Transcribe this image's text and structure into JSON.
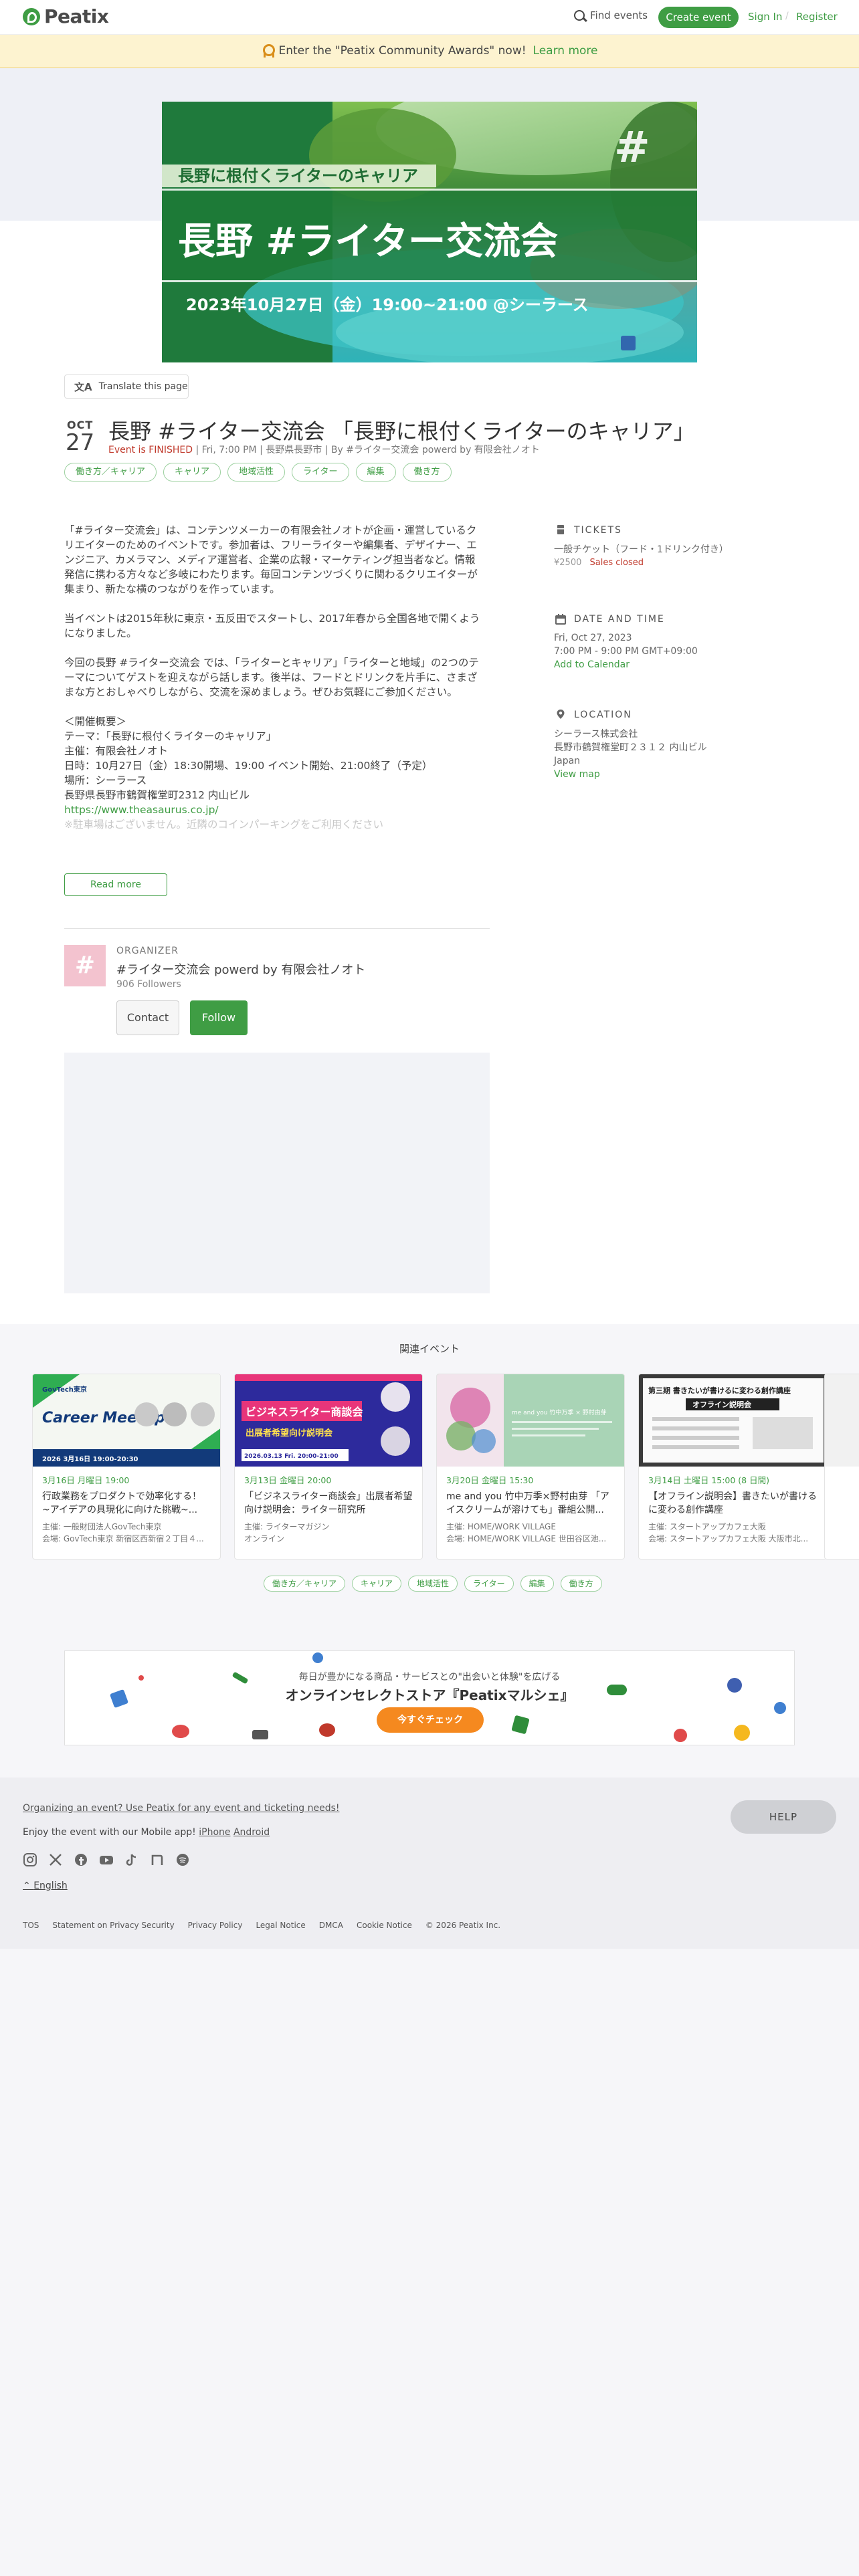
{
  "header": {
    "logo": "Peatix",
    "find_events": "Find events",
    "create_event": "Create event",
    "sign_in": "Sign In",
    "separator": "/",
    "register": "Register"
  },
  "banner": {
    "text": "Enter the \"Peatix Community Awards\" now!",
    "link": "Learn more"
  },
  "cover": {
    "subtitle": "長野に根付くライターのキャリア",
    "title": "長野 #ライター交流会",
    "datetime": "2023年10月27日（金）19:00~21:00 @シーラース",
    "hash_mark": "#"
  },
  "translate_button": "Translate this page",
  "event": {
    "month": "OCT",
    "day": "27",
    "title": "長野 #ライター交流会 「長野に根付くライターのキャリア」",
    "status": "Event is FINISHED",
    "meta": "| Fri, 7:00 PM | 長野県長野市 | By #ライター交流会 powerd by 有限会社ノオト"
  },
  "tags": [
    "働き方／キャリア",
    "キャリア",
    "地域活性",
    "ライター",
    "編集",
    "働き方"
  ],
  "description": {
    "para1": [
      "「#ライター交流会」は、コンテンツメーカーの有限会社ノオトが企画・運営しているク",
      "リエイターのためのイベントです。参加者は、フリーライターや編集者、デザイナー、エ",
      "ンジニア、カメラマン、メディア運営者、企業の広報・マーケティング担当者など。情報",
      "発信に携わる方々など多岐にわたります。毎回コンテンツづくりに関わるクリエイターが",
      "集まり、新たな横のつながりを作っています。"
    ],
    "para2": [
      "当イベントは2015年秋に東京・五反田でスタートし、2017年春から全国各地で開くよう",
      "になりました。"
    ],
    "para3": [
      "今回の長野 #ライター交流会 では、「ライターとキャリア」「ライターと地域」の2つのテ",
      "ーマについてゲストを迎えながら話します。後半は、フードとドリンクを片手に、さまざ",
      "まな方とおしゃべりしながら、交流を深めましょう。ぜひお気軽にご参加ください。"
    ],
    "outline": [
      "＜開催概要＞",
      "テーマ：「長野に根付くライターのキャリア」",
      "主催：有限会社ノオト",
      "日時：10月27日（金）18:30開場、19:00 イベント開始、21:00終了（予定）",
      "場所：シーラース",
      "長野県長野市鶴賀権堂町2312 内山ビル"
    ],
    "url": "https://www.theasaurus.co.jp/",
    "faded": "※駐車場はございません。近隣のコインパーキングをご利用ください",
    "read_more": "Read more"
  },
  "sidebar": {
    "tickets_heading": "TICKETS",
    "ticket_name": "一般チケット（フード・1ドリンク付き）",
    "ticket_price": "¥2500",
    "ticket_status": "Sales closed",
    "date_heading": "DATE AND TIME",
    "date_line1": "Fri, Oct 27, 2023",
    "date_line2": "7:00 PM - 9:00 PM GMT+09:00",
    "add_calendar": "Add to Calendar",
    "location_heading": "LOCATION",
    "venue": "シーラース株式会社",
    "address": "長野市鶴賀権堂町２３１２ 内山ビル",
    "country": "Japan",
    "view_map": "View map"
  },
  "organizer": {
    "label": "ORGANIZER",
    "name": "#ライター交流会 powerd by 有限会社ノオト",
    "followers": "906 Followers",
    "contact": "Contact",
    "follow": "Follow",
    "avatar": "#"
  },
  "related": {
    "title": "関連イベント",
    "cards": [
      {
        "date": "3月16日 月曜日 19:00",
        "title": "行政業務をプロダクトで効率化する！ ~アイデアの具現化に向けた挑戦~...",
        "host": "主催: 一般財団法人GovTech東京",
        "venue": "会場: GovTech東京 新宿区西新宿２丁目４...",
        "img_title": "Career Meetup",
        "img_tag": "GovTech東京",
        "img_date": "2026 3月16日 19:00-20:30"
      },
      {
        "date": "3月13日 金曜日 20:00",
        "title": "「ビジネスライター商談会」出展者希望向け説明会：ライター研究所",
        "host": "主催: ライターマガジン",
        "venue": "オンライン",
        "img_title": "ビジネスライター商談会",
        "img_sub": "出展者希望向け説明会",
        "img_date": "2026.03.13 Fri. 20:00-21:00"
      },
      {
        "date": "3月20日 金曜日 15:30",
        "title": "me and you 竹中万季×野村由芽 「アイスクリームが溶けても」番組公開...",
        "host": "主催: HOME/WORK VILLAGE",
        "venue": "会場: HOME/WORK VILLAGE 世田谷区池...",
        "img_text": "me and you 竹中万季 × 野村由芽"
      },
      {
        "date": "3月14日 土曜日 15:00 (8 日間)",
        "title": "【オフライン説明会】書きたいが書けるに変わる創作講座",
        "host": "主催: スタートアップカフェ大阪",
        "venue": "会場: スタートアップカフェ大阪 大阪市北...",
        "img_title": "第三期 書きたいが書けるに変わる創作講座",
        "img_sub": "オフライン説明会"
      }
    ]
  },
  "ad": {
    "line1": "毎日が豊かになる商品・サービスとの\"出会いと体験\"を広げる",
    "line2": "オンラインセレクトストア『Peatixマルシェ』",
    "button": "今すぐチェック"
  },
  "footer": {
    "organizing": "Organizing an event? Use Peatix for any event and ticketing needs!",
    "app_text": "Enjoy the event with our Mobile app!",
    "iphone": "iPhone",
    "android": "Android",
    "help": "HELP",
    "language": "English",
    "links": [
      "TOS",
      "Statement on Privacy Security",
      "Privacy Policy",
      "Legal Notice",
      "DMCA",
      "Cookie Notice",
      "© 2026 Peatix Inc."
    ]
  },
  "colors": {
    "brand_green": "#3f9d44",
    "finished_red": "#c0392b",
    "banner_bg": "#fdf3d0"
  }
}
